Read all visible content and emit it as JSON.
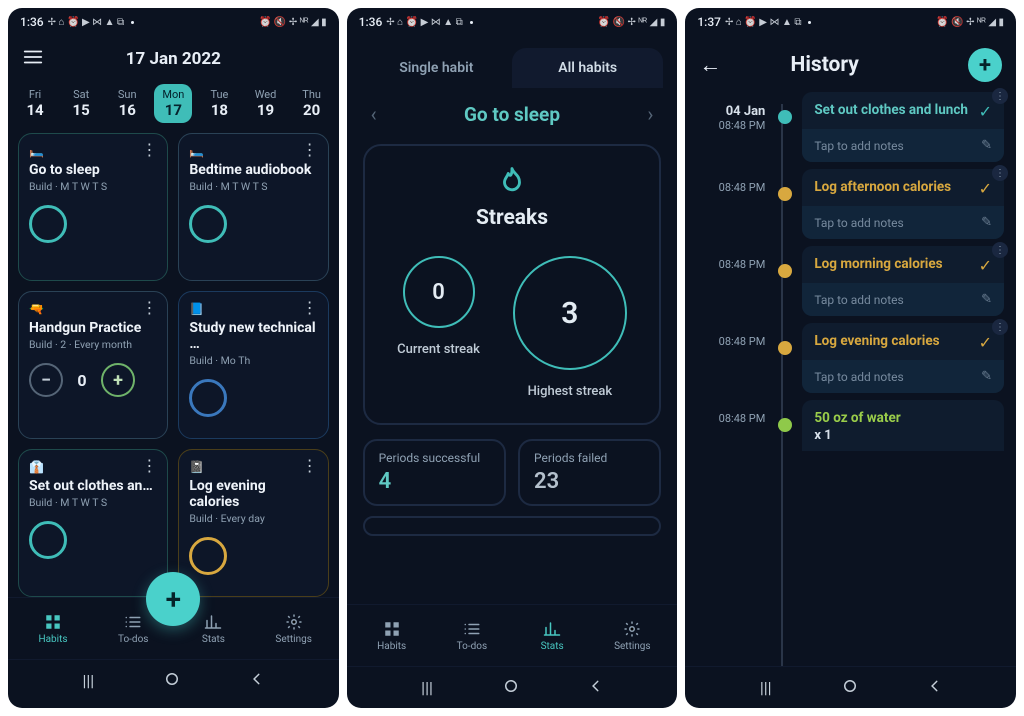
{
  "status": {
    "time1": "1:36",
    "time2": "1:36",
    "time3": "1:37",
    "icons_left": "✢ ⌂ ⏰ ▶ ⋈ ▲ ⧉",
    "icons_right": "⏰ 🔇 ✢ ᴺᴿ ◢ ▮"
  },
  "screen1": {
    "title": "17 Jan 2022",
    "days": [
      {
        "dow": "Fri",
        "num": "14",
        "selected": false
      },
      {
        "dow": "Sat",
        "num": "15",
        "selected": false
      },
      {
        "dow": "Sun",
        "num": "16",
        "selected": false
      },
      {
        "dow": "Mon",
        "num": "17",
        "selected": true
      },
      {
        "dow": "Tue",
        "num": "18",
        "selected": false
      },
      {
        "dow": "Wed",
        "num": "19",
        "selected": false
      },
      {
        "dow": "Thu",
        "num": "20",
        "selected": false
      }
    ],
    "cards": {
      "sleep": {
        "emoji": "🛏️",
        "title": "Go to sleep",
        "sub": "Build · M T W T S"
      },
      "audio": {
        "emoji": "🛏️",
        "title": "Bedtime audiobook",
        "sub": "Build · M T W T S"
      },
      "handgun": {
        "emoji": "🔫",
        "title": "Handgun Practice",
        "sub": "Build · 2 · Every month",
        "value": "0"
      },
      "study": {
        "emoji": "📘",
        "title": "Study new technical …",
        "sub": "Build · Mo Th"
      },
      "clothes": {
        "emoji": "👔",
        "title": "Set out clothes an…",
        "sub": "Build · M T W T S"
      },
      "log_eve": {
        "emoji": "📓",
        "title": "Log evening calories",
        "sub": "Build · Every day"
      }
    },
    "tabs": {
      "habits": "Habits",
      "todos": "To-dos",
      "stats": "Stats",
      "settings": "Settings"
    }
  },
  "screen2": {
    "seg": {
      "single": "Single habit",
      "all": "All habits"
    },
    "habit_name": "Go to sleep",
    "streaks_title": "Streaks",
    "current": {
      "value": "0",
      "label": "Current streak"
    },
    "highest": {
      "value": "3",
      "label": "Highest streak"
    },
    "success": {
      "label": "Periods successful",
      "value": "4"
    },
    "failed": {
      "label": "Periods failed",
      "value": "23"
    }
  },
  "screen3": {
    "title": "History",
    "notes_placeholder": "Tap to add notes",
    "items": [
      {
        "date": "04 Jan",
        "time": "08:48 PM",
        "title": "Set out clothes and lunch",
        "color": "teal"
      },
      {
        "date": "",
        "time": "08:48 PM",
        "title": "Log afternoon calories",
        "color": "amber"
      },
      {
        "date": "",
        "time": "08:48 PM",
        "title": "Log morning calories",
        "color": "amber"
      },
      {
        "date": "",
        "time": "08:48 PM",
        "title": "Log evening calories",
        "color": "amber"
      },
      {
        "date": "",
        "time": "08:48 PM",
        "title": "50 oz of water",
        "sub": "x 1",
        "color": "lime"
      }
    ]
  }
}
